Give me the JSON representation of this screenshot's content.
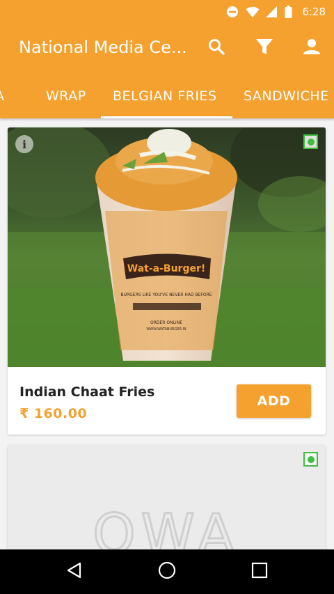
{
  "status_bar": {
    "time": "6:28",
    "icons": [
      "do-not-disturb-icon",
      "wifi-icon",
      "signal-icon",
      "battery-icon"
    ]
  },
  "app_bar": {
    "title": "National Media Ce...",
    "actions": [
      "search-icon",
      "filter-icon",
      "account-icon"
    ]
  },
  "tabs": {
    "items": [
      {
        "label": "A"
      },
      {
        "label": "WRAP"
      },
      {
        "label": "BELGIAN FRIES",
        "selected": true
      },
      {
        "label": "SANDWICHE"
      }
    ]
  },
  "menu_items": [
    {
      "name": "Indian Chaat Fries",
      "price": "₹ 160.00",
      "add_label": "ADD",
      "veg": true,
      "image_text": [
        "Wat-a-Burger!",
        "BURGERS LIKE YOU'VE NEVER HAD BEFORE",
        "ORDER ONLINE",
        "WWW.WATABURGER.IN"
      ]
    },
    {
      "veg": true,
      "image_text": [
        "OWA"
      ]
    }
  ],
  "colors": {
    "accent": "#f5a12f",
    "veg_green": "#3fbf3f",
    "background": "#f3f3f3"
  },
  "nav_bar": {
    "icons": [
      "back-icon",
      "home-icon",
      "recents-icon"
    ]
  }
}
